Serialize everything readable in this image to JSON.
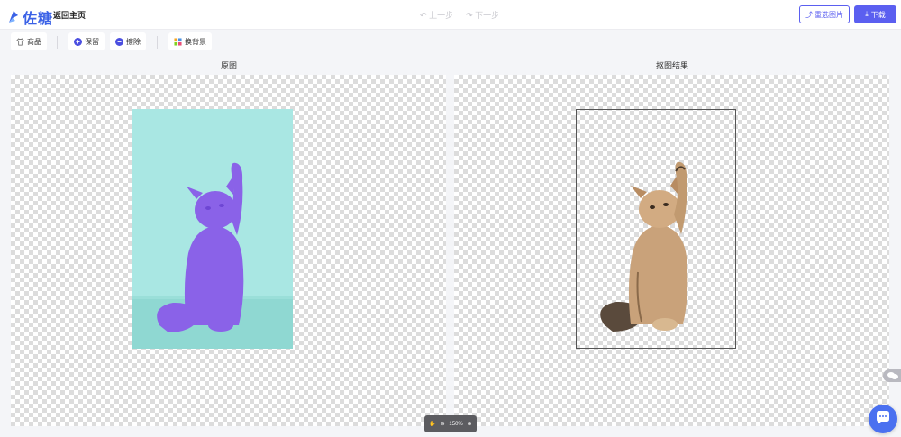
{
  "header": {
    "logo_text": "佐糖",
    "home_label": "返回主页",
    "undo_label": "上一步",
    "redo_label": "下一步",
    "reselect_label": "重选图片",
    "download_label": "下载"
  },
  "toolbar": {
    "product_label": "商品",
    "keep_label": "保留",
    "erase_label": "擦除",
    "bg_label": "换背景"
  },
  "panels": {
    "original_title": "原图",
    "result_title": "抠图结果"
  },
  "zoom": {
    "level": "150%"
  },
  "colors": {
    "accent": "#5b5ff0",
    "photo_bg": "#a7e6e1",
    "cat_original": "#8a62e8",
    "cat_result": "#c9a27a"
  },
  "icons": {
    "hand": "hand-icon",
    "zoom_out": "zoom-out-icon",
    "zoom_in": "zoom-in-icon"
  }
}
